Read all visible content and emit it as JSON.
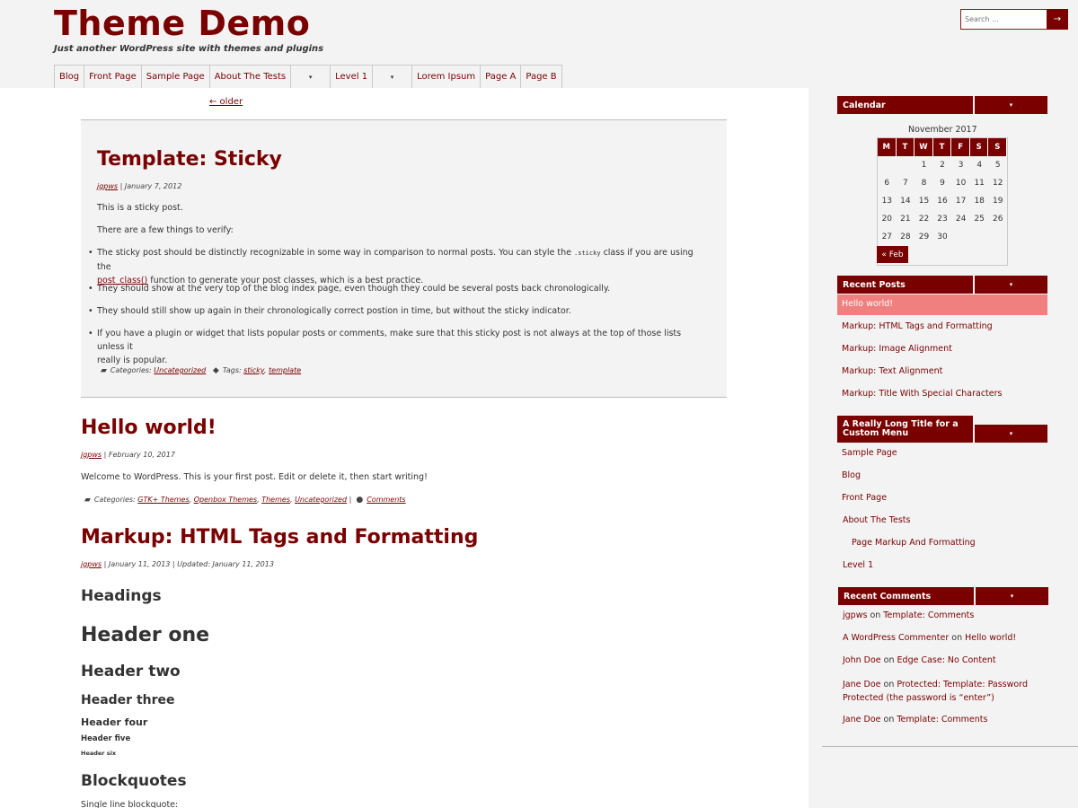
{
  "site": {
    "title": "Theme Demo",
    "description": "Just another WordPress site with themes and plugins"
  },
  "search": {
    "placeholder": "Search ...",
    "button_icon": "→"
  },
  "nav": {
    "items": [
      "Blog",
      "Front Page",
      "Sample Page",
      "About The Tests",
      "▾",
      "Level 1",
      "▾",
      "Lorem Ipsum",
      "Page A",
      "Page B"
    ]
  },
  "main": {
    "older_label": "← older",
    "sticky": {
      "title": "Template: Sticky",
      "author": "jgpws",
      "date": "January 7, 2012",
      "sep": " | ",
      "p1": "This is a sticky post.",
      "p2": "There are a few things to verify:",
      "b1a": "The sticky post should be distinctly recognizable in some way in comparison to normal posts. You can style the ",
      "b1code": ".sticky",
      "b1b": " class if you are using the",
      "b1link": "post_class()",
      "b1c": " function to generate your post classes, which is a best practice.",
      "b2": "They should show at the very top of the blog index page, even though they could be several posts back chronologically.",
      "b3": "They should still show up again in their chronologically correct postion in time, but without the sticky indicator.",
      "b4a": "If you have a plugin or widget that lists popular posts or comments, make sure that this sticky post is not always at the top of those lists unless it",
      "b4b": "really is popular.",
      "cat_label": "Categories: ",
      "cat": "Uncategorized",
      "tag_label": "Tags: ",
      "tag1": "sticky",
      "tag_sep": ", ",
      "tag2": "template"
    },
    "hello": {
      "title": "Hello world!",
      "author": "jgpws",
      "date": "February 10, 2017",
      "body": "Welcome to WordPress. This is your first post. Edit or delete it, then start writing!",
      "cat_label": "Categories: ",
      "cats": [
        "GTK+ Themes",
        "Openbox Themes",
        "Themes",
        "Uncategorized"
      ],
      "comma": ", ",
      "pipe": " | ",
      "comments": "Comments"
    },
    "markup": {
      "title": "Markup: HTML Tags and Formatting",
      "author": "jgpws",
      "date": "January 11, 2013",
      "updated": " | Updated: January 11, 2013",
      "headings": "Headings",
      "h1": "Header one",
      "h2": "Header two",
      "h3": "Header three",
      "h4": "Header four",
      "h5": "Header five",
      "h6": "Header six",
      "blockquotes": "Blockquotes",
      "single": "Single line blockquote:"
    }
  },
  "sidebar": {
    "calendar": {
      "title": "Calendar",
      "caption": "November 2017",
      "days": [
        "M",
        "T",
        "W",
        "T",
        "F",
        "S",
        "S"
      ],
      "rows": [
        [
          "",
          "",
          "1",
          "2",
          "3",
          "4",
          "5"
        ],
        [
          "6",
          "7",
          "8",
          "9",
          "10",
          "11",
          "12"
        ],
        [
          "13",
          "14",
          "15",
          "16",
          "17",
          "18",
          "19"
        ],
        [
          "20",
          "21",
          "22",
          "23",
          "24",
          "25",
          "26"
        ],
        [
          "27",
          "28",
          "29",
          "30",
          "",
          "",
          ""
        ]
      ],
      "prev": "« Feb"
    },
    "recent_posts": {
      "title": "Recent Posts",
      "items": [
        "Hello world!",
        "Markup: HTML Tags and Formatting",
        "Markup: Image Alignment",
        "Markup: Text Alignment",
        "Markup: Title With Special Characters"
      ]
    },
    "custom_menu": {
      "title_line1": "A Really Long Title for a",
      "title_line2": "Custom Menu",
      "items": [
        "Sample Page",
        "Blog",
        "Front Page",
        "About The Tests",
        "Page Markup And Formatting",
        "Level 1"
      ]
    },
    "recent_comments": {
      "title": "Recent Comments",
      "on": " on ",
      "items": [
        {
          "author": "jgpws",
          "post": "Template: Comments"
        },
        {
          "author": "A WordPress Commenter",
          "post": "Hello world!"
        },
        {
          "author": "John Doe",
          "post": "Edge Case: No Content"
        },
        {
          "author": "Jane Doe",
          "post": "Protected: Template: Password",
          "post2": "Protected (the password is “enter”)"
        },
        {
          "author": "Jane Doe",
          "post": "Template: Comments"
        }
      ]
    },
    "caret": "▾"
  },
  "colors": {
    "accent": "#7a0000",
    "highlight": "#f08080",
    "background": "#f3f3f3"
  }
}
